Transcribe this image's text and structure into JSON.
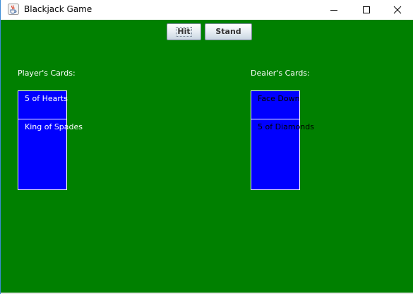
{
  "window": {
    "title": "Blackjack Game",
    "icon": "java-cup-icon",
    "controls": [
      "minimize-icon",
      "maximize-icon",
      "close-icon"
    ]
  },
  "toolbar": {
    "hit_label": "Hit",
    "stand_label": "Stand"
  },
  "player": {
    "label": "Player's Cards:",
    "cards": [
      "5 of Hearts",
      "King of Spades"
    ]
  },
  "dealer": {
    "label": "Dealer's Cards:",
    "cards": [
      "Face Down",
      "5 of Diamonds"
    ]
  },
  "colors": {
    "table_green": "#008000",
    "card_blue": "#0000ff",
    "card_border": "#ffffff",
    "label_text": "#ffffff"
  }
}
